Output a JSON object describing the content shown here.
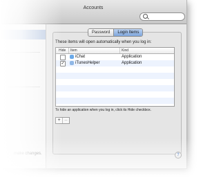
{
  "window": {
    "title": "Accounts"
  },
  "search": {
    "placeholder": ""
  },
  "tabs": [
    {
      "label": "Password",
      "selected": false
    },
    {
      "label": "Login Items",
      "selected": true
    }
  ],
  "login_items": {
    "heading": "These items will open automatically when you log in:",
    "columns": {
      "hide": "Hide",
      "item": "Item",
      "kind": "Kind"
    },
    "rows": [
      {
        "name": "iChat",
        "kind": "Application",
        "hide": false,
        "icon": "ichat-icon",
        "icon_color": "#6aa9e8"
      },
      {
        "name": "iTunesHelper",
        "kind": "Application",
        "hide": true,
        "icon": "itunes-helper-icon",
        "icon_color": "#8fb7e6"
      }
    ],
    "hint": "To hide an application when you log in, click its Hide checkbox.",
    "add_label": "+",
    "remove_label": "–"
  },
  "footer": {
    "lock_text": "make changes.",
    "help_label": "?"
  },
  "colors": {
    "selection": "#b9c9e2",
    "alt_row": "#edf3fe",
    "tab_selected": "#7ea6dc"
  }
}
